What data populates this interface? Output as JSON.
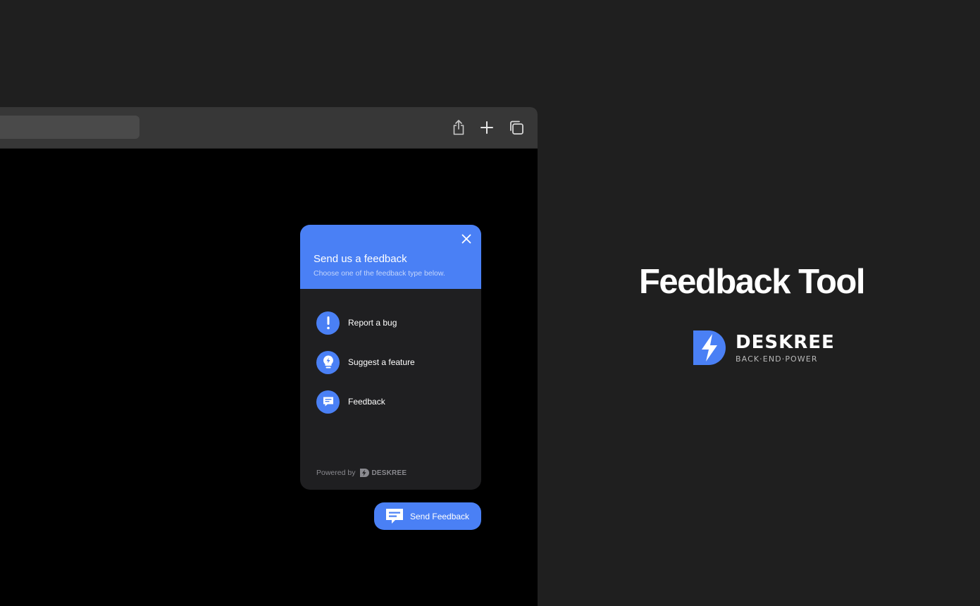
{
  "browser": {
    "toolbar": {
      "icons": [
        "share-icon",
        "plus-icon",
        "tabs-icon"
      ]
    }
  },
  "widget": {
    "title": "Send us a feedback",
    "subtitle": "Choose one of the feedback type below.",
    "options": [
      {
        "label": "Report a bug",
        "icon": "exclamation-icon"
      },
      {
        "label": "Suggest a feature",
        "icon": "lightbulb-icon"
      },
      {
        "label": "Feedback",
        "icon": "message-icon"
      }
    ],
    "powered_by": "Powered by",
    "powered_brand": "DESKREE"
  },
  "send_button": {
    "label": "Send Feedback"
  },
  "hero": {
    "title": "Feedback Tool"
  },
  "brand": {
    "name": "DESKREE",
    "tagline": "BACK·END·POWER"
  },
  "colors": {
    "background": "#1f1f1f",
    "accent": "#4a80f5",
    "widget_body": "#1f1f21",
    "toolbar": "#373737"
  }
}
